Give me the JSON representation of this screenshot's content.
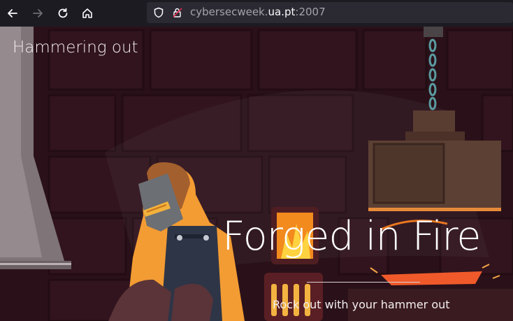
{
  "browser": {
    "url_prefix": "cybersecweek.",
    "url_host": "ua.pt",
    "url_suffix": ":2007"
  },
  "site": {
    "title": "Hammering out"
  },
  "hero": {
    "title": "Forged in Fire",
    "subtitle": "Rock out with your hammer out"
  },
  "colors": {
    "background": "#2a1119",
    "accent_fire": "#f39c33",
    "apron": "#2e3547"
  }
}
